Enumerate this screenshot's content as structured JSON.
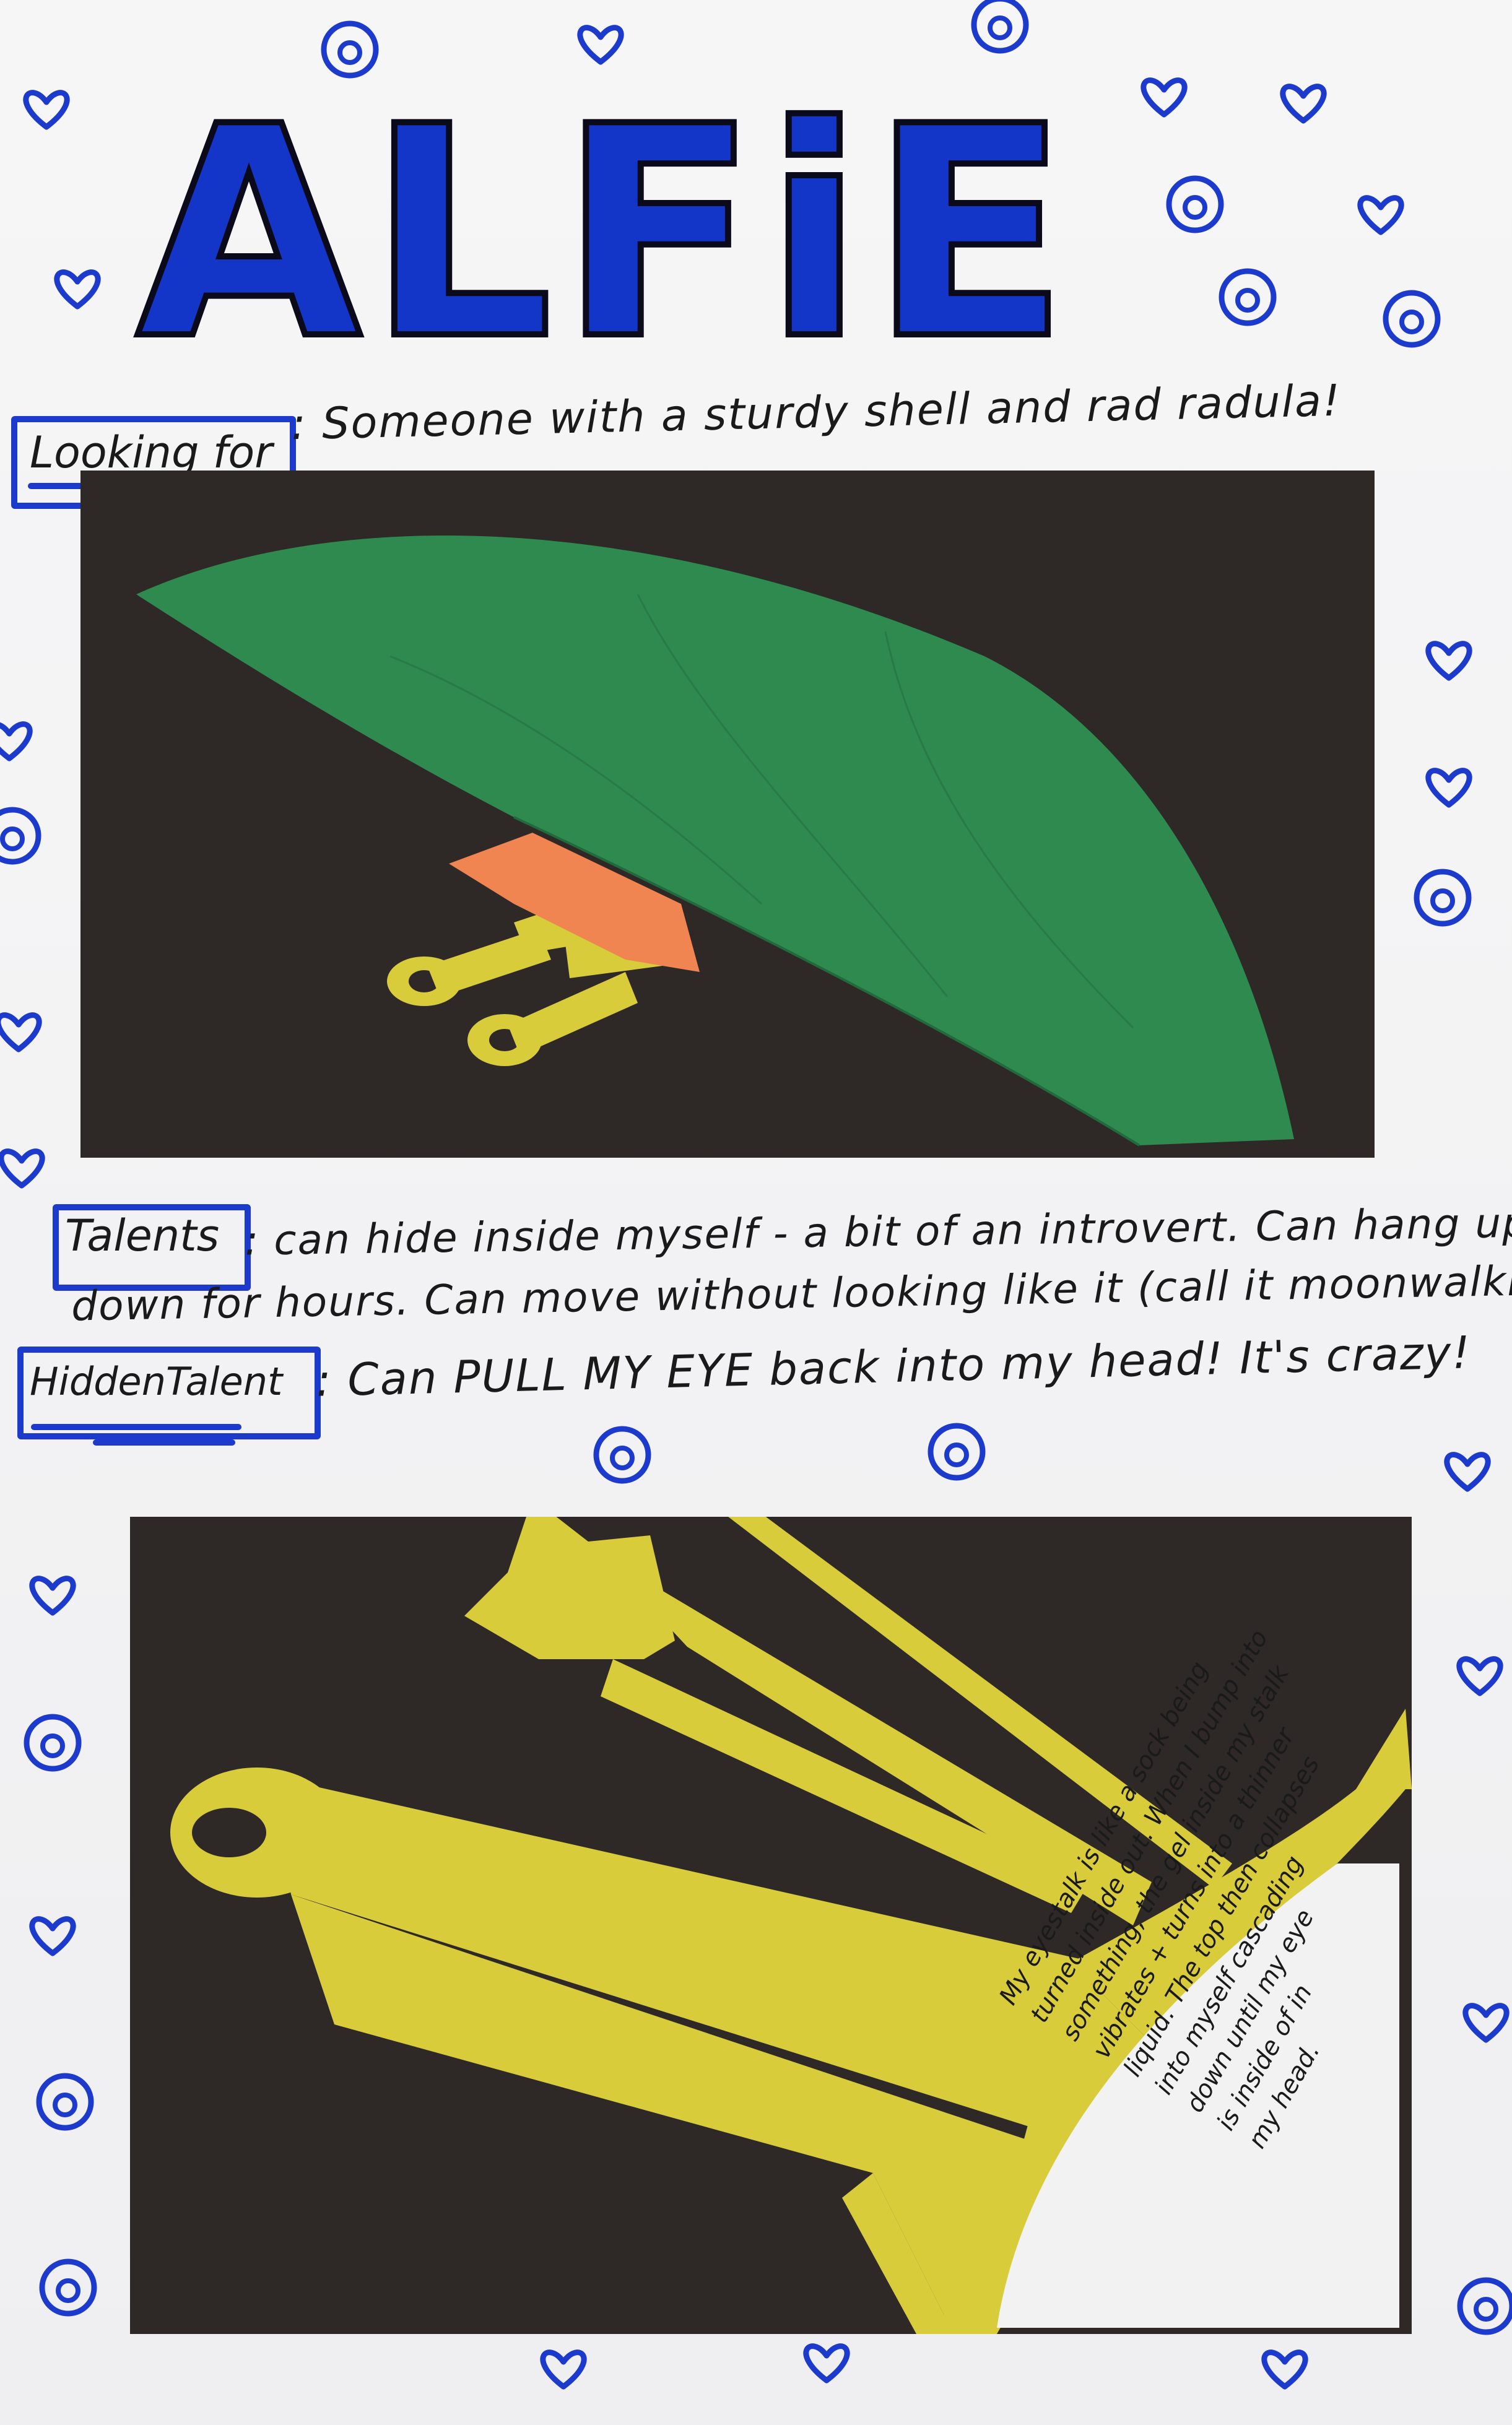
{
  "title": "ALFiE",
  "looking_for": {
    "label": "Looking for",
    "text": ": Someone with a sturdy shell and rad radula!"
  },
  "talents": {
    "label": "Talents",
    "line1": ": can hide inside myself - a bit of an introvert. Can hang upside-",
    "line2": "down for hours. Can move without looking like it (call it moonwalking!)"
  },
  "hidden_talent": {
    "label": "HiddenTalent",
    "text": ": Can PULL MY EYE back into my head! It's crazy!"
  },
  "note": {
    "line1": "My eyestalk is like a sock being",
    "line2": "turned inside out. When I bump into",
    "line3": "something, the gel inside my stalk",
    "line4": "vibrates + turns into a thinner",
    "line5": "liquid. The top then collapses",
    "line6": "into myself cascading",
    "line7": "down until my eye",
    "line8": "is inside of in",
    "line9": "my head."
  },
  "colors": {
    "ink_blue": "#1c3bcc",
    "panel_black": "#2e2826",
    "shell_green": "#2e8a4f",
    "eyestalk_yellow": "#d9cc3a",
    "body_orange": "#f08552"
  }
}
